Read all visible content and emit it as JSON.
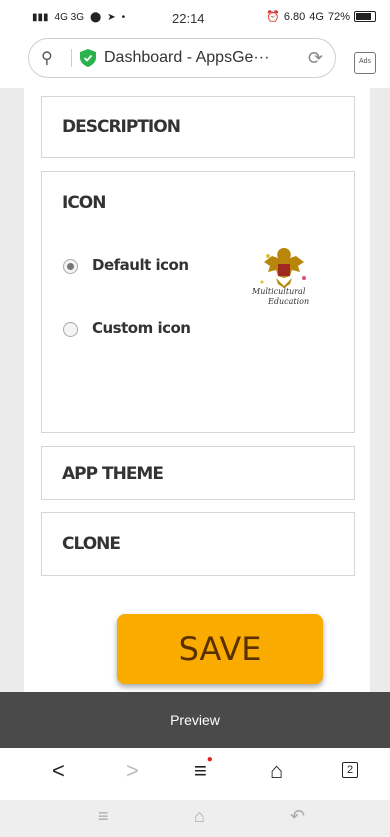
{
  "status_bar": {
    "left_indicators": "4G 3G",
    "time": "22:14",
    "speed": "6.80",
    "battery": "72%"
  },
  "browser": {
    "url_title": "Dashboard - AppsGe···",
    "ads_label": "Ads"
  },
  "sections": {
    "description": "DESCRIPTION",
    "icon": "ICON",
    "app_theme": "APP THEME",
    "clone": "CLONE"
  },
  "icon_options": {
    "default_label": "Default icon",
    "custom_label": "Custom icon",
    "selected": "default",
    "preview_caption_1": "Multicultural",
    "preview_caption_2": "Education"
  },
  "save_label": "SAVE",
  "preview_label": "Preview",
  "browser_nav": {
    "tab_count": "2"
  },
  "colors": {
    "save_bg": "#f9ab00",
    "preview_bar_bg": "#4a4a4a",
    "shield_green": "#2bb24c"
  }
}
